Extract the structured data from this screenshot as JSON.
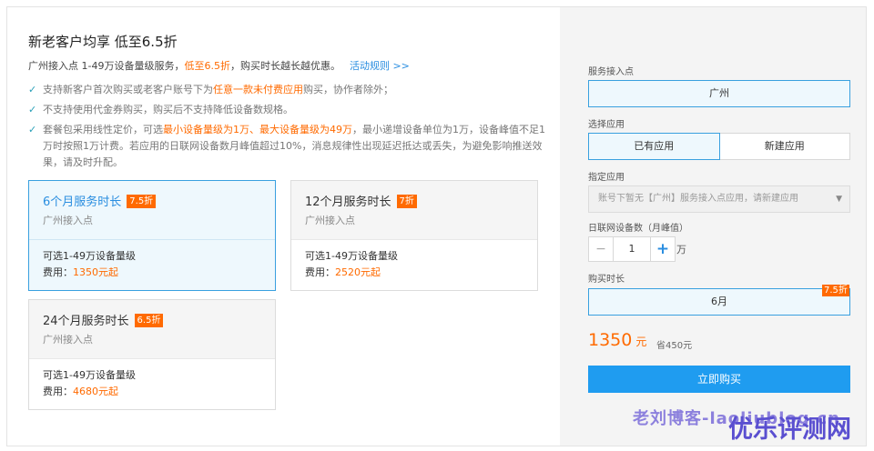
{
  "left": {
    "title": "新老客户均享 低至6.5折",
    "subline": {
      "prefix": "广州接入点 1-49万设备量级服务，",
      "highlight": "低至6.5折",
      "suffix": "，购买时长越长越优惠。",
      "link": "活动规则 >>"
    },
    "bullets": [
      {
        "pre": "支持新客户首次购买或老客户账号下为",
        "hl": "任意一款未付费应用",
        "post": "购买，协作者除外；",
        "hl2": "",
        "post2": ""
      },
      {
        "pre": "不支持使用代金券购买，购买后不支持降低设备数规格。",
        "hl": "",
        "post": "",
        "hl2": "",
        "post2": ""
      },
      {
        "pre": "套餐包采用线性定价，可选",
        "hl": "最小设备量级为1万、最大设备量级为49万",
        "post": "，最小递增设备单位为1万，设备峰值不足1万时按照1万计费。若应用的日联网设备数月峰值超过10%，消息规律性出现延迟抵达或丢失，为避免影响推送效果，请及时升配。",
        "hl2": "",
        "post2": ""
      }
    ],
    "cards": [
      {
        "title": "6个月服务时长",
        "badge": "7.5折",
        "sub": "广州接入点",
        "line1": "可选1-49万设备量级",
        "fee_label": "费用：",
        "fee": "1350元起",
        "active": true
      },
      {
        "title": "12个月服务时长",
        "badge": "7折",
        "sub": "广州接入点",
        "line1": "可选1-49万设备量级",
        "fee_label": "费用：",
        "fee": "2520元起",
        "active": false
      },
      {
        "title": "24个月服务时长",
        "badge": "6.5折",
        "sub": "广州接入点",
        "line1": "可选1-49万设备量级",
        "fee_label": "费用：",
        "fee": "4680元起",
        "active": false
      }
    ]
  },
  "right": {
    "access_label": "服务接入点",
    "access_value": "广州",
    "app_label": "选择应用",
    "app_options": [
      "已有应用",
      "新建应用"
    ],
    "assign_label": "指定应用",
    "assign_placeholder": "账号下暂无【广州】服务接入点应用，请新建应用",
    "devices_label": "日联网设备数（月峰值）",
    "devices_value": "1",
    "devices_unit": "万",
    "period_label": "购买时长",
    "period_value": "6月",
    "period_badge": "7.5折",
    "price": "1350",
    "price_unit": "元",
    "save_text": "省450元",
    "buy_label": "立即购买"
  },
  "watermark": {
    "text1": "老刘博客-laoliublog.cn",
    "text2": "优乐评测网"
  },
  "colors": {
    "accent": "#1f9cf0",
    "highlight": "#ff6a00",
    "selected_border": "#39a0df"
  }
}
